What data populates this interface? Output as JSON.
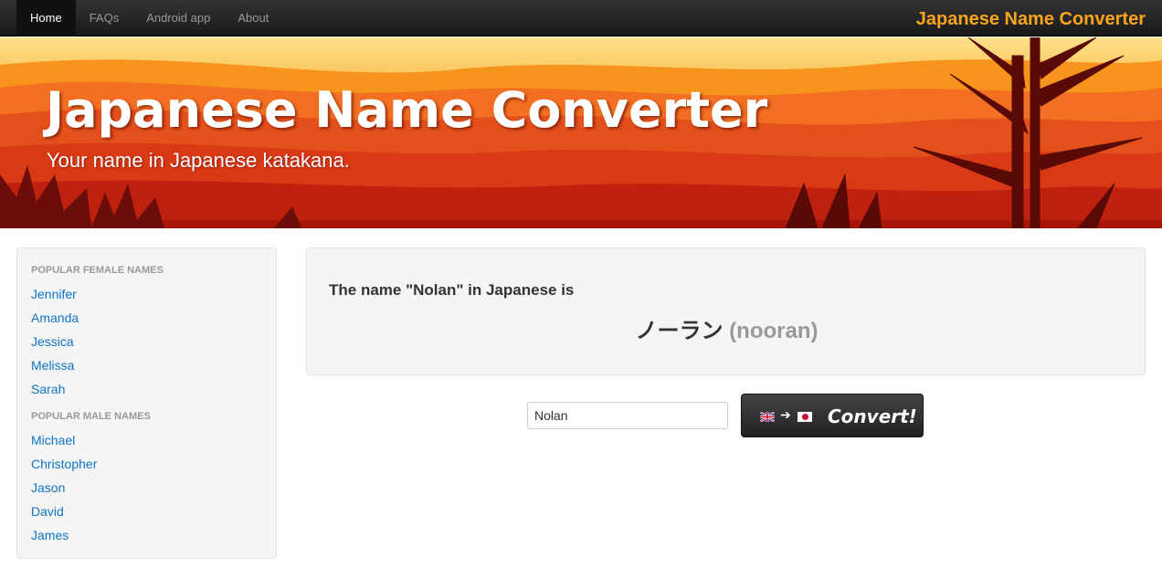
{
  "nav": {
    "items": [
      {
        "label": "Home",
        "active": true
      },
      {
        "label": "FAQs",
        "active": false
      },
      {
        "label": "Android app",
        "active": false
      },
      {
        "label": "About",
        "active": false
      }
    ],
    "brand": "Japanese Name Converter"
  },
  "hero": {
    "title": "Japanese Name Converter",
    "subtitle": "Your name in Japanese katakana."
  },
  "sidebar": {
    "female_header": "Popular female names",
    "female_names": [
      "Jennifer",
      "Amanda",
      "Jessica",
      "Melissa",
      "Sarah"
    ],
    "male_header": "Popular male names",
    "male_names": [
      "Michael",
      "Christopher",
      "Jason",
      "David",
      "James"
    ]
  },
  "result": {
    "label": "The name \"Nolan\" in Japanese is",
    "katakana": "ノーラン",
    "romaji": "(nooran)"
  },
  "form": {
    "input_value": "Nolan",
    "arrow": "➔",
    "button_label": "Convert!"
  },
  "colors": {
    "brand": "#f9a41a",
    "link": "#0e75c4",
    "hero_red": "#e45a12"
  }
}
